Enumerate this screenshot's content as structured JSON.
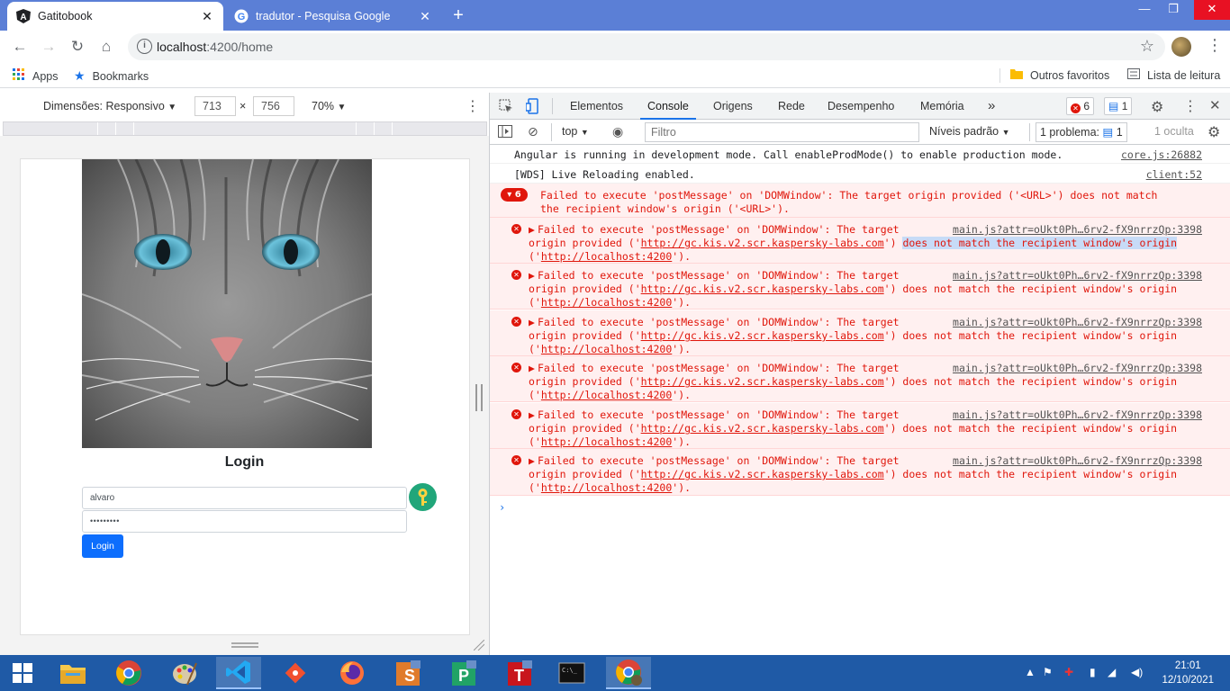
{
  "browser": {
    "tabs": [
      {
        "title": "Gatitobook",
        "icon": "angular-icon",
        "active": true
      },
      {
        "title": "tradutor - Pesquisa Google",
        "icon": "google-icon",
        "active": false
      }
    ],
    "url_host": "localhost",
    "url_path": ":4200/home",
    "bookmarks": {
      "apps": "Apps",
      "bookmarks": "Bookmarks",
      "other": "Outros favoritos",
      "reading_list": "Lista de leitura"
    }
  },
  "device_toolbar": {
    "dimensions_label": "Dimensões: Responsivo",
    "width": "713",
    "height": "756",
    "times": "×",
    "zoom": "70%"
  },
  "page": {
    "title": "Login",
    "username": "alvaro",
    "password_mask": "•••••••••",
    "login_button": "Login"
  },
  "devtools": {
    "tabs": [
      "Elementos",
      "Console",
      "Origens",
      "Rede",
      "Desempenho",
      "Memória"
    ],
    "active_tab": "Console",
    "more": "»",
    "error_count": "6",
    "message_count": "1",
    "context": "top",
    "filter_placeholder": "Filtro",
    "levels": "Níveis padrão",
    "problems": "1 problema:",
    "problems_count": "1",
    "hidden": "1 oculta",
    "messages": {
      "info1": {
        "text": "Angular is running in development mode. Call enableProdMode() to enable production mode.",
        "source": "core.js:26882"
      },
      "info2": {
        "text": "[WDS] Live Reloading enabled.",
        "source": "client:52"
      },
      "group": {
        "count": "6",
        "line1": "Failed to execute 'postMessage' on 'DOMWindow': The target origin provided ('<URL>') does not match",
        "line2": "the recipient window's origin ('<URL>')."
      },
      "error_line1": "Failed to execute 'postMessage' on 'DOMWindow': The target",
      "error_line2a": "origin provided ('",
      "error_url": "http://gc.kis.v2.scr.kaspersky-labs.com",
      "error_line2b": "') does not match the recipient window's origin",
      "error_line3a": "('",
      "error_origin": "http://localhost:4200",
      "error_line3b": "').",
      "error_source": "main.js?attr=oUkt0Ph…6rv2-fX9nrrzQp:3398"
    }
  },
  "taskbar": {
    "time": "21:01",
    "date": "12/10/2021"
  }
}
